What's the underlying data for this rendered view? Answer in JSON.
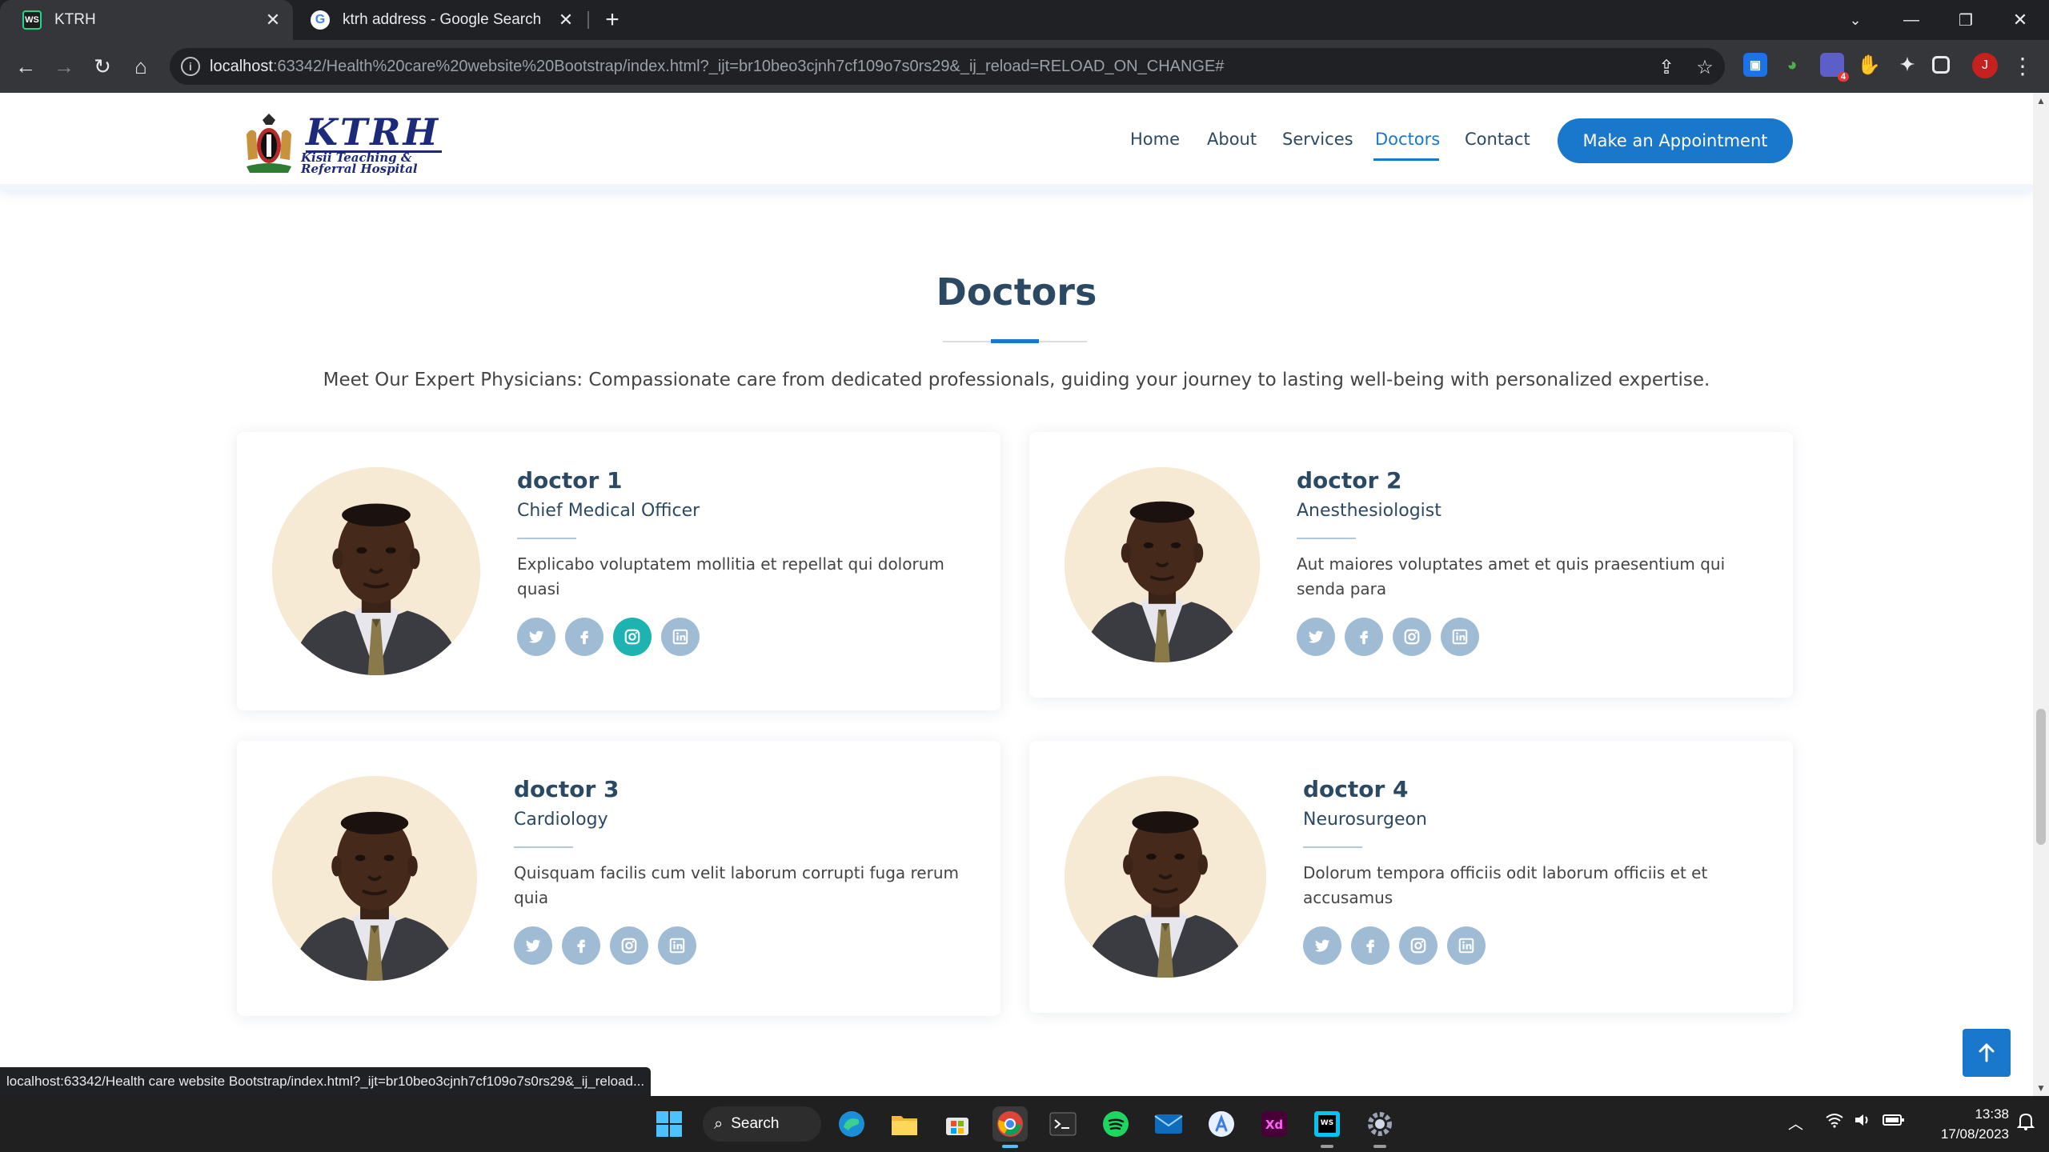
{
  "browser": {
    "tabs": [
      {
        "title": "KTRH",
        "favicon": "WS",
        "active": true
      },
      {
        "title": "ktrh address - Google Search",
        "favicon": "G",
        "active": false
      }
    ],
    "url_host": "localhost",
    "url_rest": ":63342/Health%20care%20website%20Bootstrap/index.html?_ijt=br10beo3cjnh7cf109o7s0rs29&_ij_reload=RELOAD_ON_CHANGE#",
    "profile_initial": "J",
    "status_url": "localhost:63342/Health care website Bootstrap/index.html?_ijt=br10beo3cjnh7cf109o7s0rs29&_ij_reload...",
    "extension_badge": "4"
  },
  "site": {
    "logo_text": "KTRH",
    "logo_subtext": "Kisii Teaching & Referral Hospital",
    "nav": [
      {
        "label": "Home",
        "active": false
      },
      {
        "label": "About",
        "active": false
      },
      {
        "label": "Services",
        "active": false
      },
      {
        "label": "Doctors",
        "active": true
      },
      {
        "label": "Contact",
        "active": false
      }
    ],
    "cta_label": "Make an Appointment",
    "accent_color": "#1977cc",
    "heading_color": "#2c4964"
  },
  "doctors_section": {
    "title": "Doctors",
    "subtitle": "Meet Our Expert Physicians: Compassionate care from dedicated professionals, guiding your journey to lasting well-being with personalized expertise.",
    "doctors": [
      {
        "name": "doctor 1",
        "role": "Chief Medical Officer",
        "bio": "Explicabo voluptatem mollitia et repellat qui dolorum quasi"
      },
      {
        "name": "doctor 2",
        "role": "Anesthesiologist",
        "bio": "Aut maiores voluptates amet et quis praesentium qui senda para"
      },
      {
        "name": "doctor 3",
        "role": "Cardiology",
        "bio": "Quisquam facilis cum velit laborum corrupti fuga rerum quia"
      },
      {
        "name": "doctor 4",
        "role": "Neurosurgeon",
        "bio": "Dolorum tempora officiis odit laborum officiis et et accusamus"
      }
    ],
    "social_icons": [
      "twitter-icon",
      "facebook-icon",
      "instagram-icon",
      "linkedin-icon"
    ]
  },
  "taskbar": {
    "search_label": "Search",
    "time": "13:38",
    "date": "17/08/2023"
  }
}
